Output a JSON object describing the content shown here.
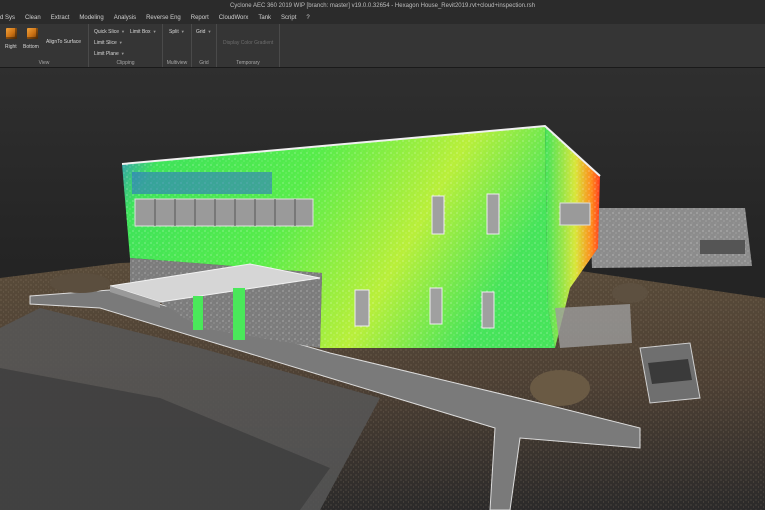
{
  "window": {
    "title": "Cyclone AEC 360 2019 WIP [branch: master] v19.0.0.32654 - Hexagon House_Revit2019.rvt+cloud+inspection.rsh"
  },
  "menu": {
    "items": [
      "d Sys",
      "Clean",
      "Extract",
      "Modeling",
      "Analysis",
      "Reverse Eng",
      "Report",
      "CloudWorx",
      "Tank",
      "Script",
      "?"
    ]
  },
  "ribbon": {
    "view": {
      "label": "View",
      "right_label": "Right",
      "bottom_label": "Bottom",
      "align_label": "AlignTo Surface",
      "right_icon": "cube-right-icon",
      "bottom_icon": "cube-bottom-icon"
    },
    "clipping": {
      "label": "Clipping",
      "quick_slice": "Quick Slice",
      "limit_box": "Limit Box",
      "limit_slice": "Limit Slice",
      "limit_plane": "Limit Plane"
    },
    "multiview": {
      "label": "Multiview",
      "split": "Split"
    },
    "grid": {
      "label": "Grid",
      "grid": "Grid"
    },
    "temporary": {
      "label": "Temporary",
      "display_color_gradient": "Display Color Gradient"
    }
  },
  "colors": {
    "title_bg": "#2b2b2b",
    "ribbon_bg": "#353535",
    "accent_icon": "#f2a23a",
    "cloud_green": "#3ee35a",
    "cloud_yellow": "#e8e22a",
    "cloud_red": "#ff3b1e"
  }
}
